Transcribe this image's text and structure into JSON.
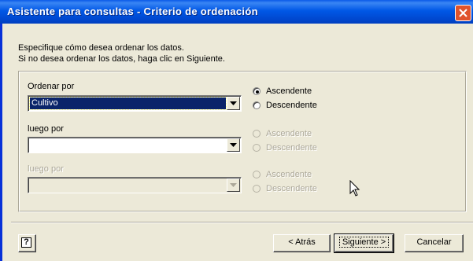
{
  "window": {
    "title": "Asistente para consultas - Criterio de ordenación"
  },
  "instructions": {
    "line1": "Especifique cómo desea ordenar los datos.",
    "line2": "Si no desea ordenar los datos, haga clic en Siguiente."
  },
  "sort_levels": [
    {
      "label": "Ordenar por",
      "field_value": "Cultivo",
      "enabled": true,
      "order_options": [
        "Ascendente",
        "Descendente"
      ],
      "selected_order": "Ascendente"
    },
    {
      "label": "luego por",
      "field_value": "",
      "enabled": true,
      "order_options": [
        "Ascendente",
        "Descendente"
      ],
      "selected_order": null
    },
    {
      "label": "luego por",
      "field_value": "",
      "enabled": false,
      "order_options": [
        "Ascendente",
        "Descendente"
      ],
      "selected_order": null
    }
  ],
  "buttons": {
    "help": "?",
    "back": "< Atrás",
    "next": "Siguiente >",
    "cancel": "Cancelar"
  },
  "colors": {
    "titlebar": "#0058e6",
    "dialog_bg": "#ece9d8",
    "selection": "#0a246a",
    "close_button": "#e0532c"
  }
}
